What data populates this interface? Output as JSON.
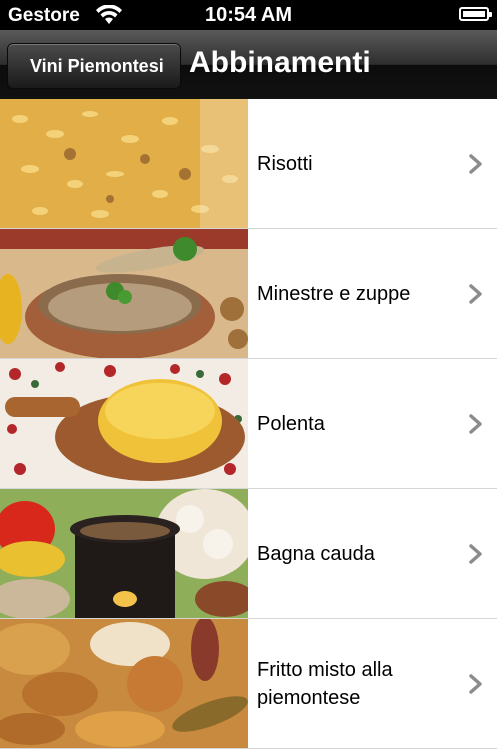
{
  "status_bar": {
    "carrier": "Gestore",
    "time": "10:54 AM",
    "icons": [
      "wifi-icon",
      "battery-icon"
    ],
    "battery_level": 1.0
  },
  "nav": {
    "back_label": "Vini Piemontesi",
    "title": "Abbinamenti"
  },
  "items": [
    {
      "label": "Risotti",
      "icon": "risotto-photo"
    },
    {
      "label": "Minestre e zuppe",
      "icon": "soup-photo"
    },
    {
      "label": "Polenta",
      "icon": "polenta-photo"
    },
    {
      "label": "Bagna cauda",
      "icon": "bagna-cauda-photo"
    },
    {
      "label": "Fritto misto alla piemontese",
      "icon": "fritto-misto-photo"
    }
  ]
}
